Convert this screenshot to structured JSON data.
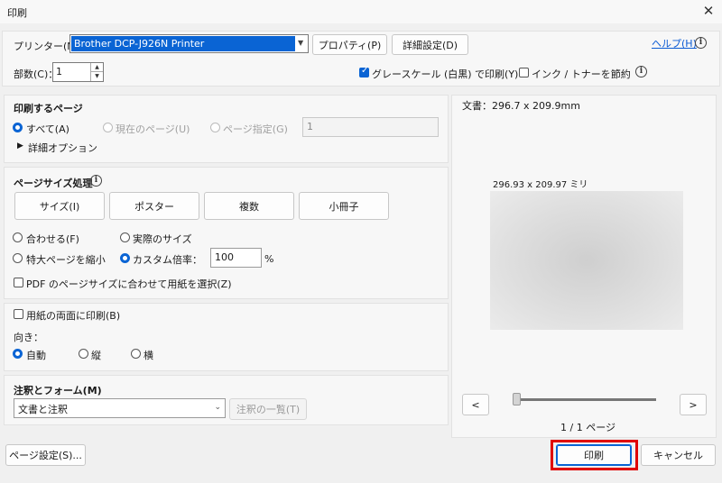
{
  "window": {
    "title": "印刷",
    "close_glyph": "✕"
  },
  "printer": {
    "label": "プリンター(N)：",
    "value": "Brother DCP-J926N Printer",
    "properties_label": "プロパティ(P)",
    "advanced_label": "詳細設定(D)",
    "help_label": "ヘルプ(H)"
  },
  "copies": {
    "label": "部数(C)：",
    "value": "1"
  },
  "grayscale": {
    "label": "グレースケール (白黒) で印刷(Y)",
    "checked": true
  },
  "save_ink": {
    "label": "インク / トナーを節約",
    "checked": false
  },
  "print_range": {
    "title": "印刷するページ",
    "all_label": "すべて(A)",
    "current_label": "現在のページ(U)",
    "pages_label": "ページ指定(G)",
    "pages_value": "1",
    "more_options_label": "詳細オプション",
    "more_options_glyph": "▶"
  },
  "page_sizing": {
    "title": "ページサイズ処理",
    "buttons": [
      "サイズ(I)",
      "ポスター",
      "複数",
      "小冊子"
    ],
    "fit_label": "合わせる(F)",
    "actual_label": "実際のサイズ",
    "shrink_label": "特大ページを縮小",
    "custom_label": "カスタム倍率：",
    "custom_value": "100",
    "percent": "%",
    "pdf_paper_label": "PDF のページサイズに合わせて用紙を選択(Z)"
  },
  "duplex": {
    "label": "用紙の両面に印刷(B)"
  },
  "orientation": {
    "label": "向き：",
    "auto": "自動",
    "portrait": "縦",
    "landscape": "横"
  },
  "comments": {
    "title": "注釈とフォーム(M)",
    "value": "文書と注釈",
    "summary_label": "注釈の一覧(T)"
  },
  "preview": {
    "doc_size": "文書：296.7 x 209.9mm",
    "page_size": "296.93 x 209.97 ミリ",
    "prev": "<",
    "next": ">",
    "page_indicator": "1 / 1 ページ"
  },
  "footer": {
    "page_setup_label": "ページ設定(S)...",
    "print_label": "印刷",
    "cancel_label": "キャンセル"
  },
  "colors": {
    "accent": "#0a64d4",
    "highlight": "#e00000"
  }
}
